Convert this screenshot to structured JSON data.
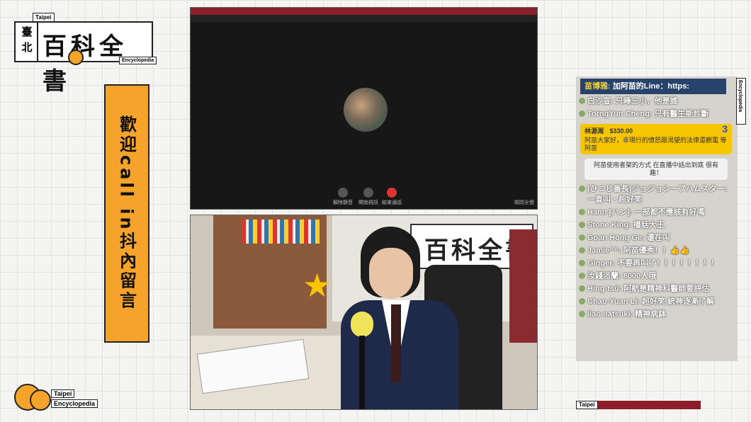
{
  "logo": {
    "tag": "Taipei",
    "city": "臺北",
    "title": "百科全書",
    "subtitle": "Encyclopedia"
  },
  "callin": {
    "text": "歡迎call in抖內留言"
  },
  "logo_bottom": {
    "line1": "Taipei",
    "line2": "Encyclopedia"
  },
  "zoom": {
    "controls": [
      {
        "label": "解除靜音",
        "icon": "microphone-icon"
      },
      {
        "label": "開始視訊",
        "icon": "camera-icon"
      },
      {
        "label": "結束通話",
        "icon": "end-call-icon"
      }
    ],
    "right_label": "關閉全螢"
  },
  "camera": {
    "banner_text": "百科全書"
  },
  "chat": {
    "pinned": {
      "author": "苗博雅:",
      "text": "加阿苗的Line：https:"
    },
    "messages": [
      {
        "author": "白沙宣",
        "text": "只睡三小，他是誰"
      },
      {
        "author": "TorngYun Cheng",
        "text": "只有醫生能診斷"
      }
    ],
    "superchat": {
      "author": "林源湘",
      "amount": "$330.00",
      "number": "3",
      "text": "阿苗大家好，非現行的憤怒跟渴望的法律還觀電 等阿苗"
    },
    "sticker_text": "阿苗使用者架的方式 在直播中話出到底 很有趣！",
    "messages2": [
      {
        "author": "[ひつじ番長]ジョジョシープハムスター",
        "text": "一直叫‧超好笑"
      },
      {
        "author": "Hann [ハン]",
        "text": "一部都不應該有好嗎"
      },
      {
        "author": "Stone King",
        "text": "播話大王"
      },
      {
        "author": "Goan Hong Ge",
        "text": "還在叫"
      },
      {
        "author": "Jamie^^",
        "text": "阿苗優秀！！👍👍"
      },
      {
        "author": "Ginger",
        "text": "不要再叫了！！！！！！！！"
      },
      {
        "author": "汝錢派蘭",
        "text": "8000人哦"
      },
      {
        "author": "Hing-tsú",
        "text": "阿航是精神科醫師要評估"
      },
      {
        "author": "Chao-Yuan Li",
        "text": "超好笑 統神逐漸了解"
      },
      {
        "author": "liao natsuki",
        "text": "精神病鉢"
      }
    ],
    "side_label": "Encyclopedia"
  },
  "bottom_tag": "Taipei"
}
